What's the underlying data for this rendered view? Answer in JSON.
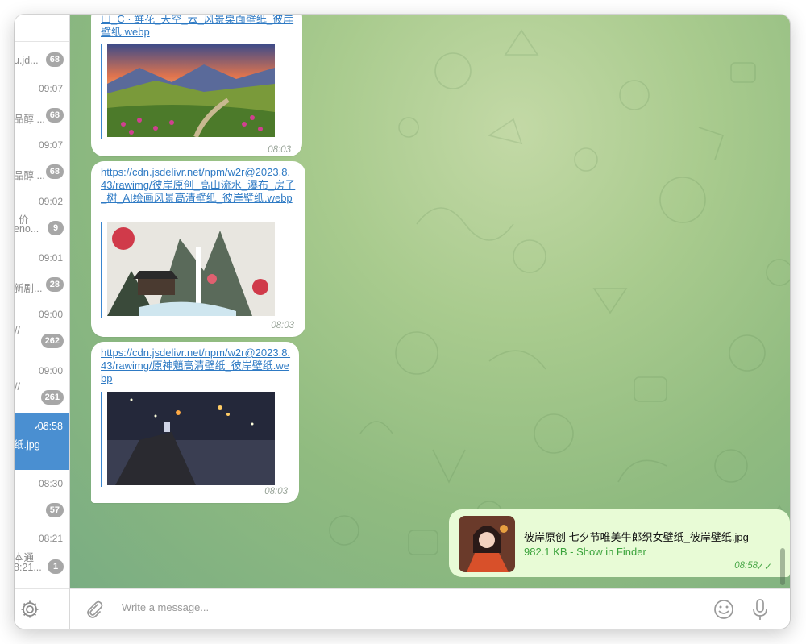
{
  "sidebar": {
    "chats": [
      {
        "time": "",
        "line1": "u.jd...",
        "line2": "",
        "badge": "68",
        "active": false
      },
      {
        "time": "09:07",
        "line1": "品醇 ...",
        "line2": "",
        "badge": "68",
        "active": false
      },
      {
        "time": "09:07",
        "line1": "品醇 ...",
        "line2": "",
        "badge": "68",
        "active": false
      },
      {
        "time": "09:02",
        "line1": "价",
        "line2": "eno...",
        "badge": "9",
        "active": false
      },
      {
        "time": "09:01",
        "line1": "新剧...",
        "line2": "",
        "badge": "28",
        "active": false
      },
      {
        "time": "09:00",
        "line1": "//",
        "line2": "",
        "badge": "262",
        "active": false
      },
      {
        "time": "09:00",
        "line1": "//",
        "line2": "",
        "badge": "261",
        "active": false
      },
      {
        "time": "08:58",
        "line1": "纸.jpg",
        "line2": "",
        "badge": "",
        "active": true,
        "checks": "✓✓"
      },
      {
        "time": "08:30",
        "line1": "",
        "line2": "",
        "badge": "57",
        "active": false
      },
      {
        "time": "08:21",
        "line1": "本通",
        "line2": "8:21...",
        "badge": "1",
        "active": false
      }
    ]
  },
  "messages": [
    {
      "link": "山_C · 鲜花_天空_云_风景桌面壁纸_彼岸壁纸.webp",
      "time": "08:03",
      "image_icon": "mountain-flower-landscape"
    },
    {
      "link": "https://cdn.jsdelivr.net/npm/w2r@2023.8.43/rawimg/彼岸原创_高山流水_瀑布_房子_树_AI绘画风景高清壁纸_彼岸壁纸.webp",
      "time": "08:03",
      "image_icon": "waterfall-house-landscape"
    },
    {
      "link": "https://cdn.jsdelivr.net/npm/w2r@2023.8.43/rawimg/原神魈高清壁纸_彼岸壁纸.webp",
      "time": "08:03",
      "image_icon": "night-lantern-scene"
    }
  ],
  "outgoing": {
    "file_name": "彼岸原创 七夕节唯美牛郎织女壁纸_彼岸壁纸.jpg",
    "size": "982.1 KB",
    "separator": " - ",
    "action": "Show in Finder",
    "time": "08:58",
    "checks": "✓✓"
  },
  "composer": {
    "placeholder": "Write a message..."
  }
}
